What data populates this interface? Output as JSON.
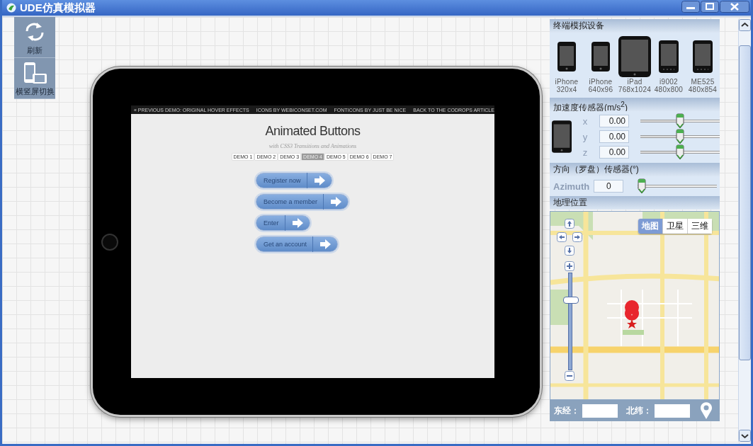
{
  "window": {
    "title": "UDE仿真模拟器"
  },
  "toolbar": [
    {
      "kind": "refresh",
      "label": "刷新"
    },
    {
      "kind": "orientation",
      "label": "横竖屏切换"
    }
  ],
  "device_screen": {
    "top_links": [
      {
        "label": "« PREVIOUS DEMO: ORIGINAL HOVER EFFECTS"
      },
      {
        "label": "ICONS BY WEBICONSET.COM"
      },
      {
        "label": "FONTICONS BY JUST BE NICE"
      },
      {
        "label": "BACK TO THE CODROPS ARTICLE"
      }
    ],
    "title": "Animated Buttons",
    "subtitle": "with CSS3 Transitions and Animations",
    "demo_tabs": [
      {
        "label": "DEMO 1",
        "selected": false
      },
      {
        "label": "DEMO 2",
        "selected": false
      },
      {
        "label": "DEMO 3",
        "selected": false
      },
      {
        "label": "DEMO 4",
        "selected": true
      },
      {
        "label": "DEMO 5",
        "selected": false
      },
      {
        "label": "DEMO 6",
        "selected": false
      },
      {
        "label": "DEMO 7",
        "selected": false
      }
    ],
    "buttons": [
      "Register now",
      "Become a member",
      "Enter",
      "Get an account"
    ]
  },
  "devices": {
    "title": "终端模拟设备",
    "items": [
      {
        "kind": "phone",
        "name": "iPhone",
        "resolution": "320x4"
      },
      {
        "kind": "phone",
        "name": "iPhone",
        "resolution": "640x96"
      },
      {
        "kind": "tablet",
        "name": "iPad",
        "resolution": "768x1024"
      },
      {
        "kind": "android",
        "name": "i9002",
        "resolution": "480x800"
      },
      {
        "kind": "android",
        "name": "ME525",
        "resolution": "480x854"
      }
    ]
  },
  "accelerometer": {
    "title": "加速度传感器(m/s$^{2}$)",
    "axes": [
      {
        "label": "x",
        "value": "0.00",
        "level": 0.5
      },
      {
        "label": "y",
        "value": "0.00",
        "level": 0.5
      },
      {
        "label": "z",
        "value": "0.00",
        "level": 0.5
      }
    ]
  },
  "compass": {
    "title": "方向（罗盘）传感器(°)",
    "label": "Azimuth",
    "value": "0",
    "level": 0
  },
  "location": {
    "title": "地理位置",
    "map_types": [
      {
        "label": "地图",
        "selected": true
      },
      {
        "label": "卫星",
        "selected": false
      },
      {
        "label": "三维",
        "selected": false
      }
    ],
    "zoom": {
      "level": 0.73
    },
    "longitude_label": "东经：",
    "latitude_label": "北纬："
  }
}
